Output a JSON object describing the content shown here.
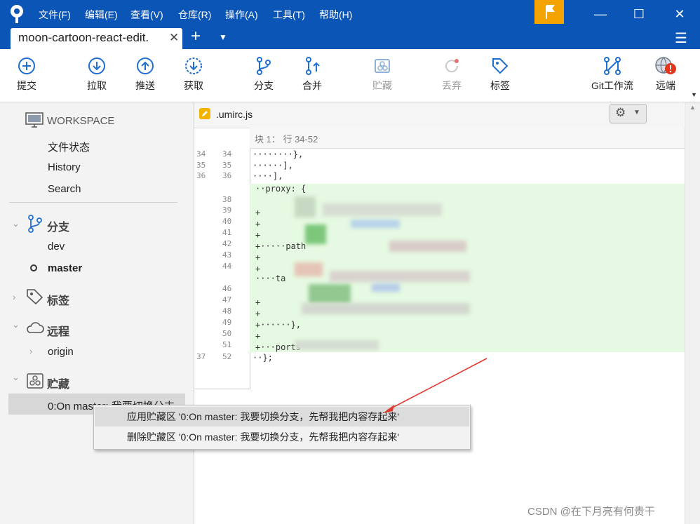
{
  "menu": [
    "文件(F)",
    "编辑(E)",
    "查看(V)",
    "仓库(R)",
    "操作(A)",
    "工具(T)",
    "帮助(H)"
  ],
  "tab": {
    "title": "moon-cartoon-react-edit.",
    "close": "✕",
    "add": "+"
  },
  "toolbar": {
    "commit": "提交",
    "pull": "拉取",
    "push": "推送",
    "fetch": "获取",
    "branch": "分支",
    "merge": "合并",
    "stash": "贮藏",
    "discard": "丢弃",
    "tag": "标签",
    "gitflow": "Git工作流",
    "remote": "远端"
  },
  "sidebar": {
    "workspace": "WORKSPACE",
    "file_status": "文件状态",
    "history": "History",
    "search": "Search",
    "branches": "分支",
    "branch_dev": "dev",
    "branch_master": "master",
    "tags": "标签",
    "remotes": "远程",
    "remote_origin": "origin",
    "stashes": "贮藏",
    "stash_item": "0:On master: 我要切换分支"
  },
  "file": {
    "name": ".umirc.js",
    "hunk": "块 1： 行 34-52"
  },
  "lines": [
    {
      "old": "34",
      "new": "34",
      "code": "········},"
    },
    {
      "old": "35",
      "new": "35",
      "code": "······],"
    },
    {
      "old": "36",
      "new": "36",
      "code": "····],"
    },
    {
      "old": "",
      "new": "38",
      "code": "··proxy: {"
    },
    {
      "old": "",
      "new": "39",
      "code": "+"
    },
    {
      "old": "",
      "new": "40",
      "code": "+"
    },
    {
      "old": "",
      "new": "41",
      "code": "+"
    },
    {
      "old": "",
      "new": "42",
      "code": "+·····path"
    },
    {
      "old": "",
      "new": "43",
      "code": "+"
    },
    {
      "old": "",
      "new": "44",
      "code": "+"
    },
    {
      "old": "",
      "new": "46",
      "code": "····ta"
    },
    {
      "old": "",
      "new": "47",
      "code": "+"
    },
    {
      "old": "",
      "new": "48",
      "code": "+"
    },
    {
      "old": "",
      "new": "49",
      "code": "+······},"
    },
    {
      "old": "",
      "new": "50",
      "code": "+"
    },
    {
      "old": "",
      "new": "51",
      "code": "+···ports"
    },
    {
      "old": "37",
      "new": "52",
      "code": "··};"
    }
  ],
  "context_menu": {
    "apply": "应用贮藏区 '0:On master: 我要切换分支，先帮我把内容存起来'",
    "delete": "删除贮藏区 '0:On master: 我要切换分支，先帮我把内容存起来'"
  },
  "watermark": "CSDN @在下月亮有何贵干",
  "colors": {
    "titlebar": "#0b55b7",
    "accent": "#1f6fd0",
    "added_bg": "#e6f9e2",
    "flag": "#f4a300",
    "alert": "#e2361d"
  }
}
